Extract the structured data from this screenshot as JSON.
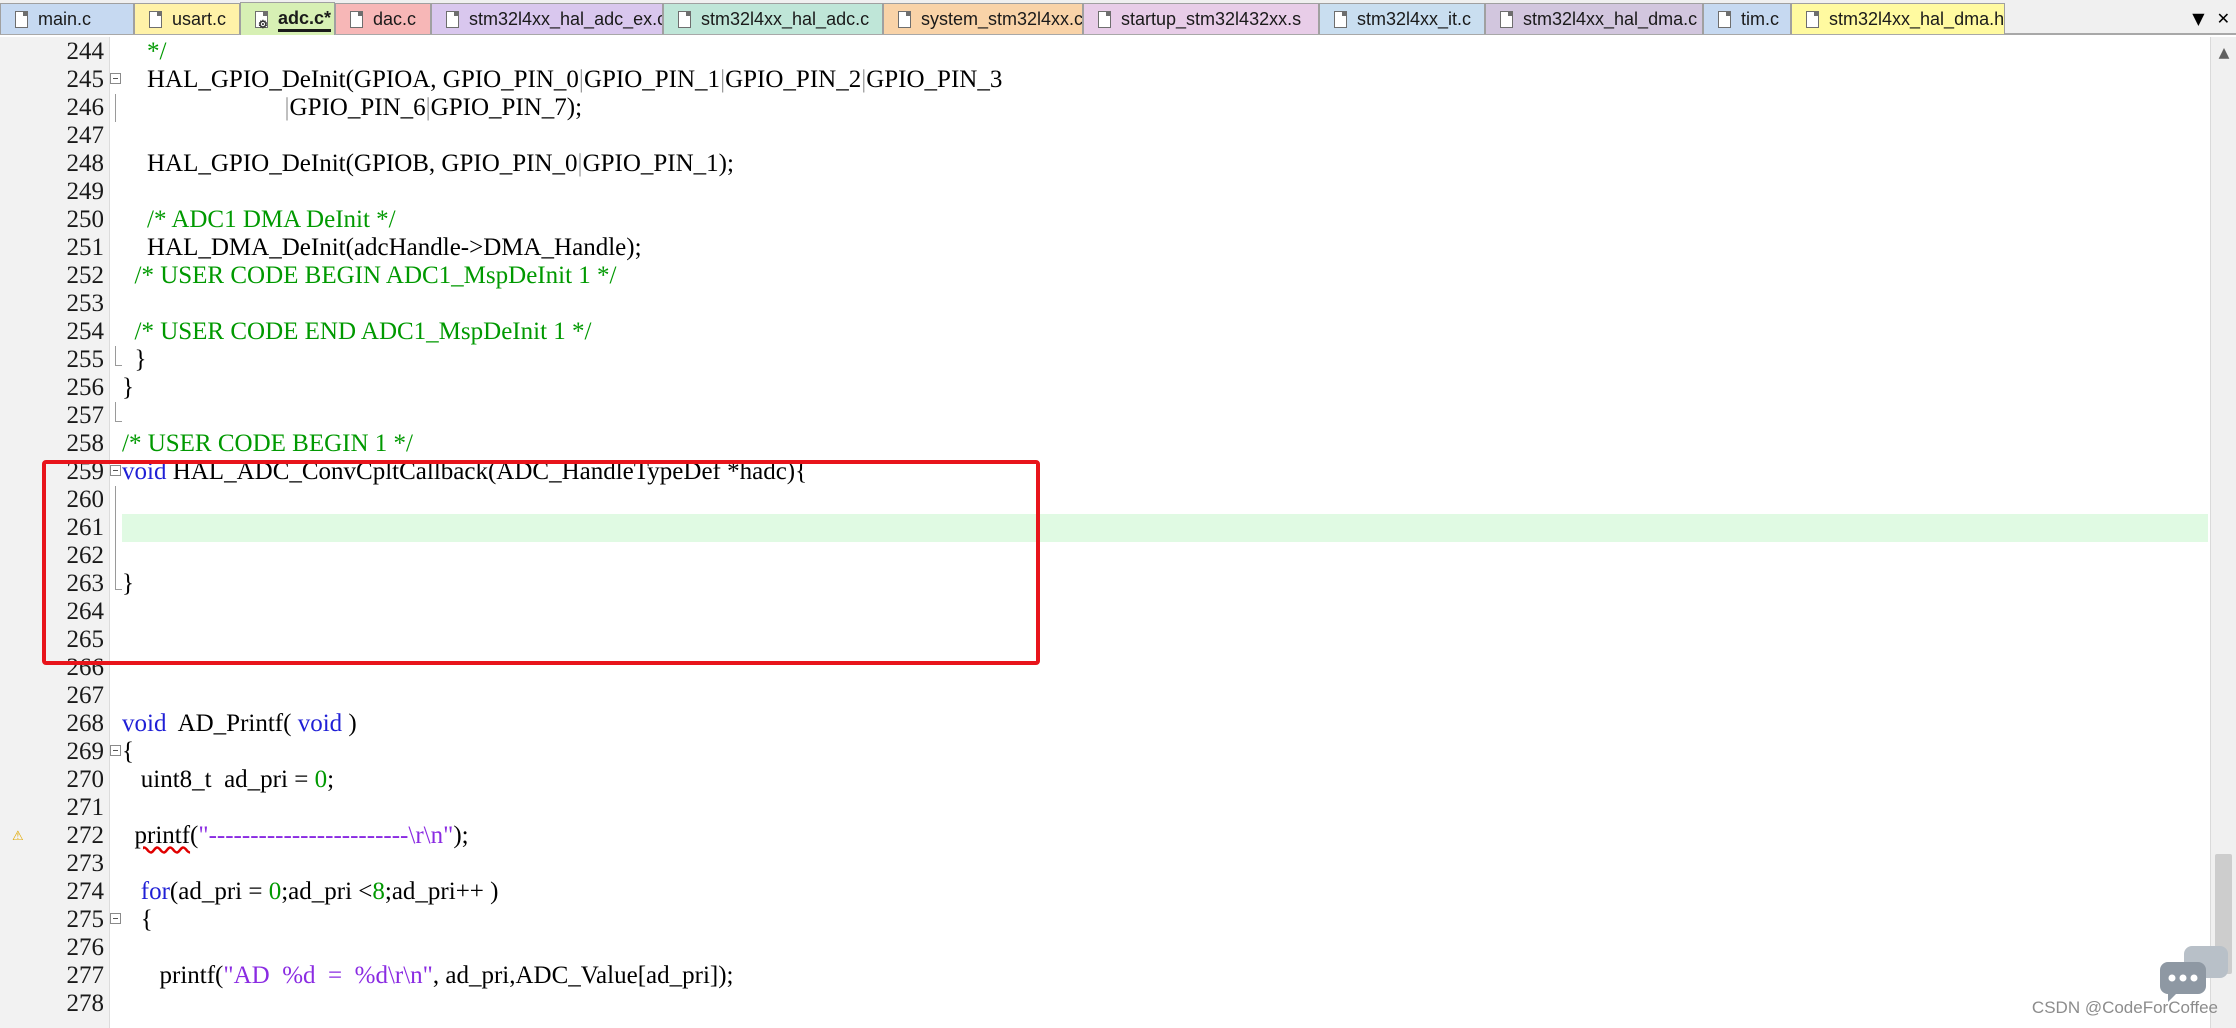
{
  "tabs": [
    {
      "label": "main.c",
      "color": "#c6d9f1",
      "active": false
    },
    {
      "label": "usart.c",
      "color": "#fff2a8",
      "active": false
    },
    {
      "label": "adc.c*",
      "color": "#d7f0b4",
      "active": true
    },
    {
      "label": "dac.c",
      "color": "#f7b7b7",
      "active": false
    },
    {
      "label": "stm32l4xx_hal_adc_ex.c",
      "color": "#d9c7ee",
      "active": false
    },
    {
      "label": "stm32l4xx_hal_adc.c",
      "color": "#bfe6d8",
      "active": false
    },
    {
      "label": "system_stm32l4xx.c",
      "color": "#f9d3a8",
      "active": false
    },
    {
      "label": "startup_stm32l432xx.s",
      "color": "#e8cde8",
      "active": false
    },
    {
      "label": "stm32l4xx_it.c",
      "color": "#c9def0",
      "active": false
    },
    {
      "label": "stm32l4xx_hal_dma.c",
      "color": "#d2c6de",
      "active": false
    },
    {
      "label": "tim.c",
      "color": "#c6d9f1",
      "active": false
    },
    {
      "label": "stm32l4xx_hal_dma.h",
      "color": "#fffaa0",
      "active": false
    }
  ],
  "tab_controls": {
    "dropdown": "▼",
    "close": "✕"
  },
  "lines": [
    {
      "n": "244",
      "segs": [
        {
          "t": "    */",
          "c": "c"
        }
      ]
    },
    {
      "n": "245",
      "segs": [
        {
          "t": "    HAL_GPIO_DeInit(GPIOA, GPIO_PIN_0",
          "c": "n"
        },
        {
          "t": "|",
          "c": "g"
        },
        {
          "t": "GPIO_PIN_1",
          "c": "n"
        },
        {
          "t": "|",
          "c": "g"
        },
        {
          "t": "GPIO_PIN_2",
          "c": "n"
        },
        {
          "t": "|",
          "c": "g"
        },
        {
          "t": "GPIO_PIN_3",
          "c": "n"
        }
      ]
    },
    {
      "n": "246",
      "segs": [
        {
          "t": "                          ",
          "c": "n"
        },
        {
          "t": "|",
          "c": "g"
        },
        {
          "t": "GPIO_PIN_6",
          "c": "n"
        },
        {
          "t": "|",
          "c": "g"
        },
        {
          "t": "GPIO_PIN_7);",
          "c": "n"
        }
      ]
    },
    {
      "n": "247",
      "segs": []
    },
    {
      "n": "248",
      "segs": [
        {
          "t": "    HAL_GPIO_DeInit(GPIOB, GPIO_PIN_0",
          "c": "n"
        },
        {
          "t": "|",
          "c": "g"
        },
        {
          "t": "GPIO_PIN_1);",
          "c": "n"
        }
      ]
    },
    {
      "n": "249",
      "segs": []
    },
    {
      "n": "250",
      "segs": [
        {
          "t": "    /* ADC1 DMA DeInit */",
          "c": "c"
        }
      ]
    },
    {
      "n": "251",
      "segs": [
        {
          "t": "    HAL_DMA_DeInit(adcHandle->DMA_Handle);",
          "c": "n"
        }
      ]
    },
    {
      "n": "252",
      "segs": [
        {
          "t": "  /* USER CODE BEGIN ADC1_MspDeInit 1 */",
          "c": "c"
        }
      ]
    },
    {
      "n": "253",
      "segs": []
    },
    {
      "n": "254",
      "segs": [
        {
          "t": "  /* USER CODE END ADC1_MspDeInit 1 */",
          "c": "c"
        }
      ]
    },
    {
      "n": "255",
      "segs": [
        {
          "t": "  }",
          "c": "n"
        }
      ]
    },
    {
      "n": "256",
      "segs": [
        {
          "t": "}",
          "c": "n"
        }
      ]
    },
    {
      "n": "257",
      "segs": []
    },
    {
      "n": "258",
      "segs": [
        {
          "t": "/* USER CODE BEGIN 1 */",
          "c": "c"
        }
      ]
    },
    {
      "n": "259",
      "segs": [
        {
          "t": "void",
          "c": "k"
        },
        {
          "t": " HAL_ADC_ConvCpltCallback(ADC_HandleTypeDef *hadc){",
          "c": "n"
        }
      ]
    },
    {
      "n": "260",
      "segs": []
    },
    {
      "n": "261",
      "segs": []
    },
    {
      "n": "262",
      "segs": []
    },
    {
      "n": "263",
      "segs": [
        {
          "t": "}",
          "c": "n"
        }
      ]
    },
    {
      "n": "264",
      "segs": []
    },
    {
      "n": "265",
      "segs": []
    },
    {
      "n": "266",
      "segs": []
    },
    {
      "n": "267",
      "segs": []
    },
    {
      "n": "268",
      "segs": [
        {
          "t": "void",
          "c": "k"
        },
        {
          "t": "  AD_Printf( ",
          "c": "n"
        },
        {
          "t": "void",
          "c": "k"
        },
        {
          "t": " )",
          "c": "n"
        }
      ]
    },
    {
      "n": "269",
      "segs": [
        {
          "t": "{",
          "c": "n"
        }
      ]
    },
    {
      "n": "270",
      "segs": [
        {
          "t": "   uint8_t  ad_pri = ",
          "c": "n"
        },
        {
          "t": "0",
          "c": "num"
        },
        {
          "t": ";",
          "c": "n"
        }
      ]
    },
    {
      "n": "271",
      "segs": []
    },
    {
      "n": "272",
      "segs": [
        {
          "t": "  ",
          "c": "n"
        },
        {
          "t": "printf",
          "c": "w"
        },
        {
          "t": "(",
          "c": "n"
        },
        {
          "t": "\"------------------------\\r\\n\"",
          "c": "s"
        },
        {
          "t": ");",
          "c": "n"
        }
      ]
    },
    {
      "n": "273",
      "segs": []
    },
    {
      "n": "274",
      "segs": [
        {
          "t": "   ",
          "c": "n"
        },
        {
          "t": "for",
          "c": "k"
        },
        {
          "t": "(ad_pri = ",
          "c": "n"
        },
        {
          "t": "0",
          "c": "num"
        },
        {
          "t": ";ad_pri <",
          "c": "n"
        },
        {
          "t": "8",
          "c": "num"
        },
        {
          "t": ";ad_pri++ )",
          "c": "n"
        }
      ]
    },
    {
      "n": "275",
      "segs": [
        {
          "t": "   {",
          "c": "n"
        }
      ]
    },
    {
      "n": "276",
      "segs": []
    },
    {
      "n": "277",
      "segs": [
        {
          "t": "      printf(",
          "c": "n"
        },
        {
          "t": "\"AD  %d  =  %d\\r\\n\"",
          "c": "s"
        },
        {
          "t": ", ad_pri,ADC_Value[ad_pri]);",
          "c": "n"
        }
      ]
    },
    {
      "n": "278",
      "segs": []
    }
  ],
  "watermark": "CSDN @CodeForCoffee"
}
